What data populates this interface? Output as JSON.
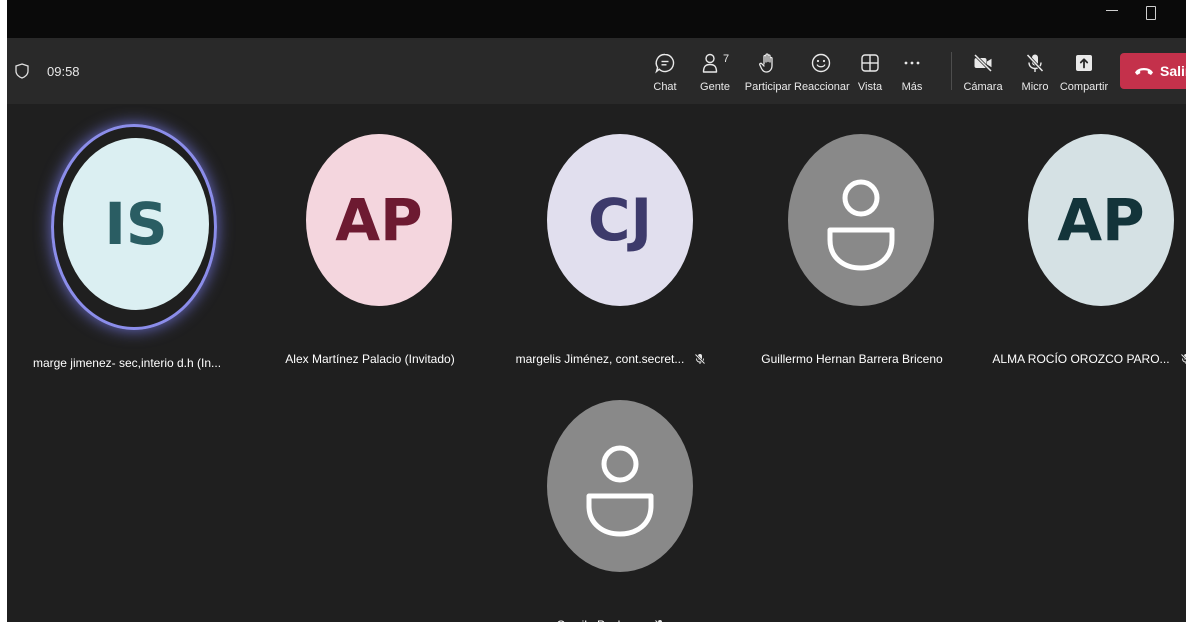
{
  "meeting": {
    "timer": "09:58"
  },
  "toolbar": {
    "chat_label": "Chat",
    "people_label": "Gente",
    "people_count": "7",
    "raise_hand_label": "Participar",
    "react_label": "Reaccionar",
    "view_label": "Vista",
    "more_label": "Más",
    "camera_label": "Cámara",
    "mic_label": "Micro",
    "share_label": "Compartir",
    "leave_label": "Salir"
  },
  "participants": [
    {
      "initials": "IS",
      "name": "marge jimenez- sec,interio d.h (In...",
      "avatar_bg": "#dbeff2",
      "initials_color": "#2a5d63",
      "muted": false,
      "speaking": true
    },
    {
      "initials": "AP",
      "name": "Alex Martínez Palacio (Invitado)",
      "avatar_bg": "#f4d6de",
      "initials_color": "#6d1a31",
      "muted": false,
      "speaking": false
    },
    {
      "initials": "CJ",
      "name": "margelis Jiménez, cont.secret...",
      "avatar_bg": "#e1dfee",
      "initials_color": "#3d3a6b",
      "muted": true,
      "speaking": false
    },
    {
      "initials": "",
      "name": "Guillermo Hernan Barrera Briceno",
      "avatar_bg": "#898989",
      "initials_color": "#ffffff",
      "muted": false,
      "speaking": false
    },
    {
      "initials": "AP",
      "name": "ALMA ROCÍO OROZCO PARO...",
      "avatar_bg": "#d5e1e4",
      "initials_color": "#13343a",
      "muted": true,
      "speaking": false
    },
    {
      "initials": "",
      "name": "Camilo Pacheco",
      "avatar_bg": "#898989",
      "initials_color": "#ffffff",
      "muted": true,
      "speaking": false
    }
  ],
  "icons": {
    "shield": "shield-icon",
    "chat": "chat-icon",
    "people": "people-icon",
    "hand": "raise-hand-icon",
    "react": "smiley-icon",
    "view": "grid-view-icon",
    "more": "more-dots-icon",
    "camera": "camera-off-icon",
    "mic": "mic-off-icon",
    "share": "share-screen-icon",
    "leave": "hang-up-icon"
  },
  "colors": {
    "leave_button": "#c4314b",
    "speaking_ring": "#8b8dea",
    "stage_bg": "#1f1f1f",
    "toolbar_bg": "#292929"
  }
}
